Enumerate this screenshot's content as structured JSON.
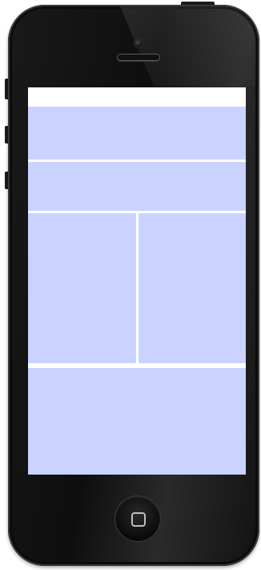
{
  "device": {
    "type": "phone",
    "frame_color": "#141414",
    "screen_background": "#ffffff"
  },
  "screen": {
    "status_bar": {
      "color": "#ffffff"
    },
    "blocks": [
      {
        "name": "block-1",
        "color": "#cad3ff"
      },
      {
        "name": "block-2",
        "color": "#cad3ff"
      },
      {
        "name": "block-3-left",
        "color": "#cad3ff"
      },
      {
        "name": "block-3-right",
        "color": "#cad3ff"
      },
      {
        "name": "block-4",
        "color": "#cad3ff"
      }
    ]
  },
  "hardware": {
    "home_button_icon": "home-square-icon",
    "camera_icon": "camera-icon",
    "speaker_icon": "speaker-icon"
  }
}
